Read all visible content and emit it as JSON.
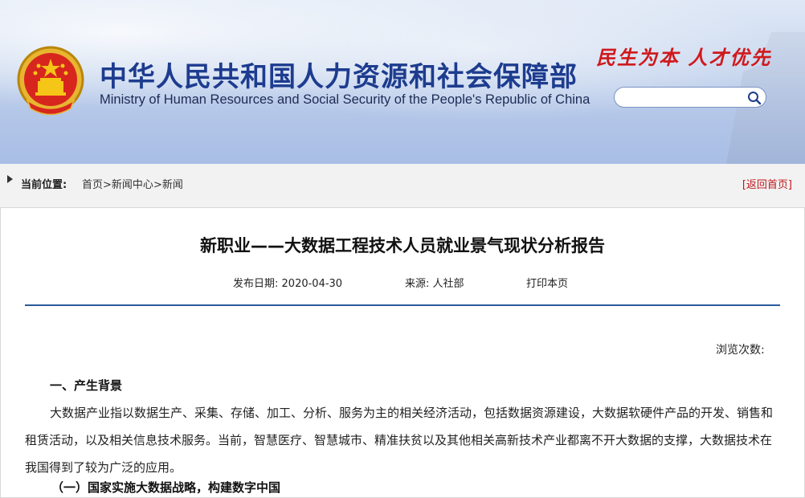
{
  "header": {
    "title_cn": "中华人民共和国人力资源和社会保障部",
    "title_en": "Ministry of Human Resources and Social Security of the People's Republic of China",
    "slogan": "民生为本 人才优先",
    "search_placeholder": ""
  },
  "breadcrumb": {
    "label": "当前位置:",
    "items": [
      "首页",
      "新闻中心",
      "新闻"
    ],
    "separator": ">",
    "back_home": "[返回首页]"
  },
  "article": {
    "title": "新职业——大数据工程技术人员就业景气现状分析报告",
    "date_label": "发布日期:",
    "date": "2020-04-30",
    "source_label": "来源:",
    "source": "人社部",
    "print": "打印本页",
    "views_label": "浏览次数:",
    "section1_heading": "一、产生背景",
    "paragraph1": "大数据产业指以数据生产、采集、存储、加工、分析、服务为主的相关经济活动，包括数据资源建设，大数据软硬件产品的开发、销售和租赁活动，以及相关信息技术服务。当前，智慧医疗、智慧城市、精准扶贫以及其他相关高新技术产业都离不开大数据的支撑，大数据技术在我国得到了较为广泛的应用。",
    "subsection1_heading": "（一）国家实施大数据战略，构建数字中国"
  },
  "colors": {
    "title_blue": "#1d3c8f",
    "slogan_red": "#d0191c",
    "rule_blue": "#2a5b9a",
    "back_home_red": "#c0161a"
  },
  "icons": {
    "emblem": "national-emblem-icon",
    "search": "search-icon",
    "breadcrumb_arrow": "triangle-right-icon"
  }
}
